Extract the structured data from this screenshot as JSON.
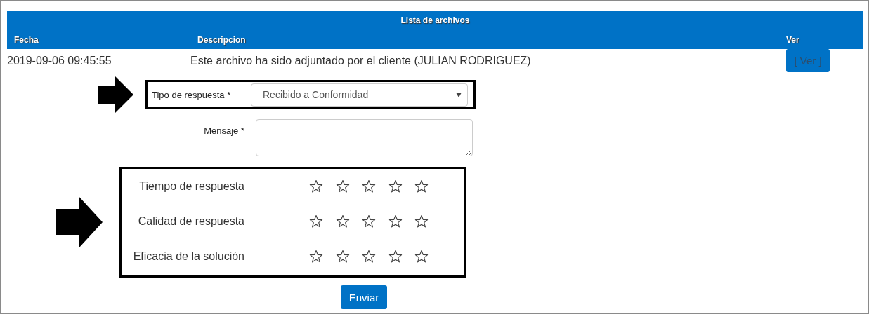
{
  "table": {
    "title": "Lista de archivos",
    "columns": [
      "Fecha",
      "Descripcion",
      "Ver"
    ],
    "rows": [
      {
        "date": "2019-09-06 09:45:55",
        "description": "Este archivo ha sido adjuntado por el cliente (JULIAN RODRIGUEZ)",
        "action": "[ Ver ]"
      }
    ]
  },
  "form": {
    "response_type": {
      "label": "Tipo de respuesta *",
      "value": "Recibido a Conformidad"
    },
    "message": {
      "label": "Mensaje *"
    }
  },
  "ratings": [
    {
      "label": "Tiempo de respuesta",
      "stars": 0
    },
    {
      "label": "Calidad de respuesta",
      "stars": 0
    },
    {
      "label": "Eficacia de la solución",
      "stars": 0
    }
  ],
  "submit": "Enviar"
}
